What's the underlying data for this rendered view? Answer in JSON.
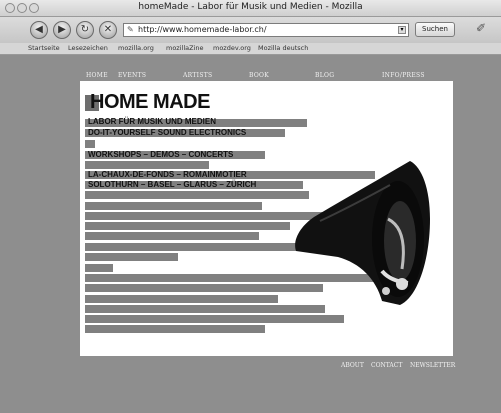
{
  "window": {
    "title": "homeMade - Labor für Musik und Medien - Mozilla"
  },
  "toolbar": {
    "url": "http://www.homemade-labor.ch/",
    "search_label": "Suchen"
  },
  "bookmarks": [
    "Startseite",
    "Lesezeichen",
    "mozilla.org",
    "mozillaZine",
    "mozdev.org",
    "Mozilla deutsch"
  ],
  "nav": [
    "HOME",
    "EVENTS",
    "ARTISTS",
    "BOOK",
    "BLOG",
    "INFO/PRESS"
  ],
  "content": {
    "title": "HOME MADE",
    "lines": [
      "LABOR FÜR MUSIK UND MEDIEN",
      "DO-IT-YOURSELF SOUND ELECTRONICS",
      "WORKSHOPS – DEMOS – CONCERTS",
      "LA-CHAUX-DE-FONDS – ROMAINMOTIER",
      "SOLOTHURN – BASEL – GLARUS – ZÜRICH"
    ]
  },
  "footer": [
    "ABOUT",
    "CONTACT",
    "NEWSLETTER"
  ]
}
